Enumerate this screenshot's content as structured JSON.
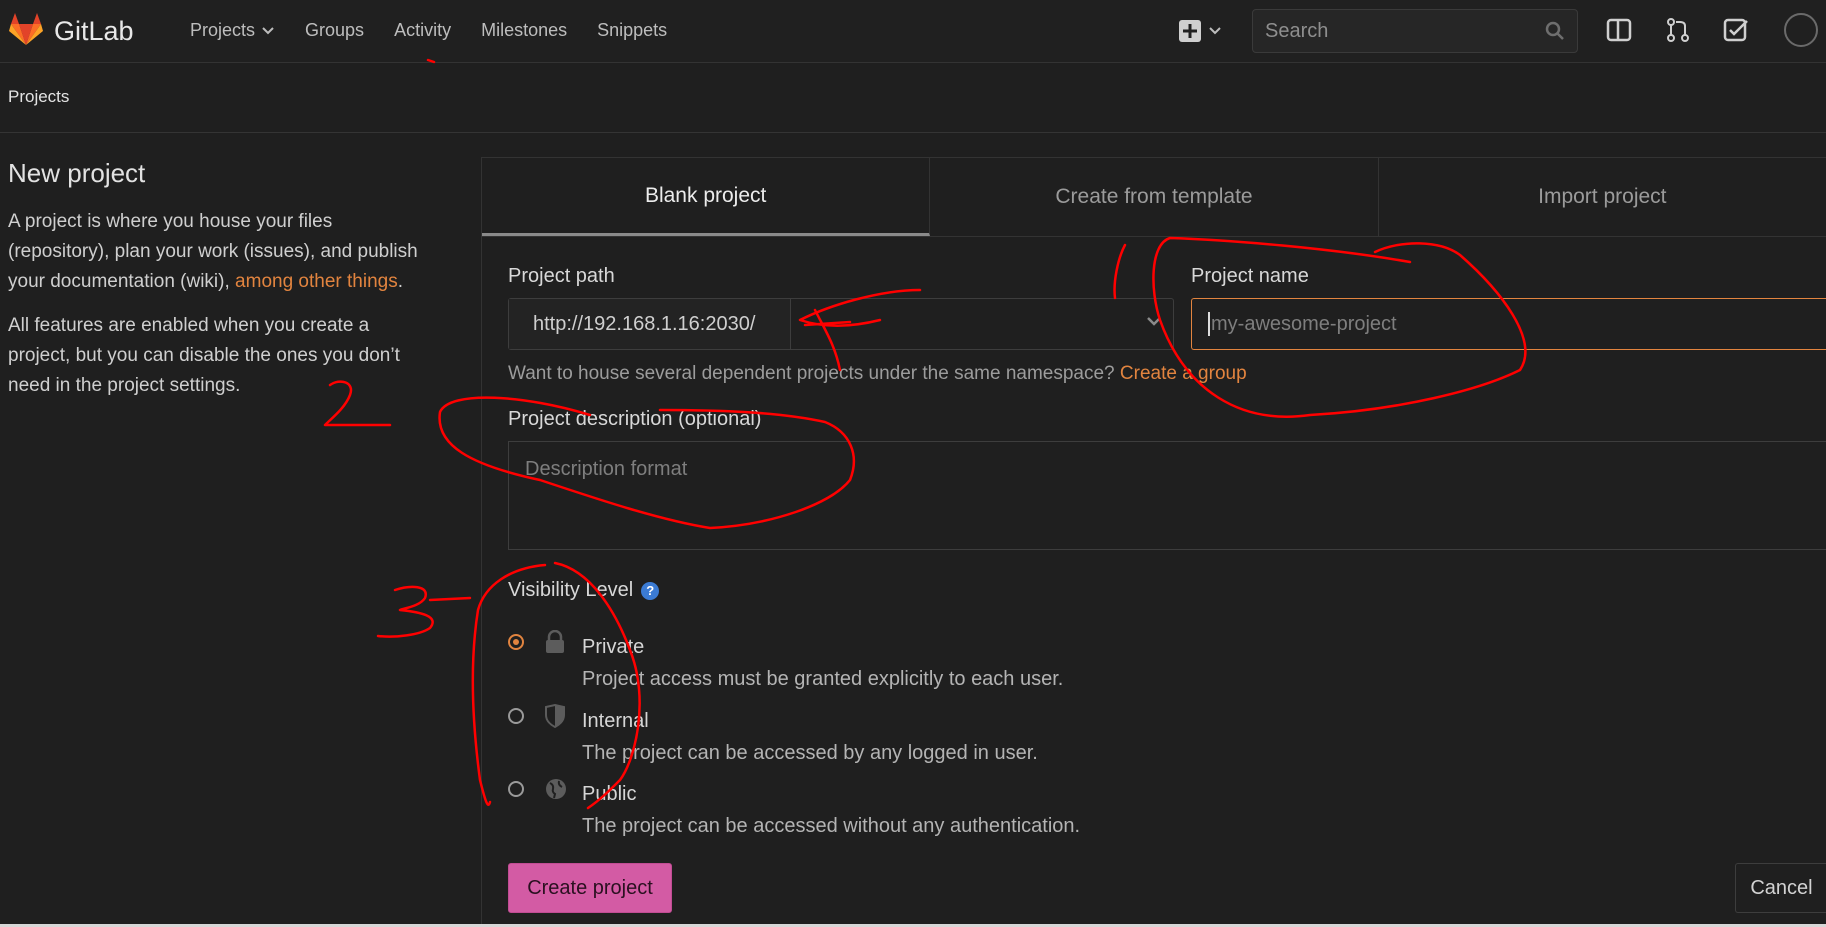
{
  "app": {
    "name": "GitLab"
  },
  "nav": {
    "projects": "Projects",
    "groups": "Groups",
    "activity": "Activity",
    "milestones": "Milestones",
    "snippets": "Snippets"
  },
  "search": {
    "placeholder": "Search"
  },
  "breadcrumb": {
    "current": "Projects"
  },
  "intro": {
    "title": "New project",
    "para1_text": "A project is where you house your files (repository), plan your work (issues), and publish your documentation (wiki), ",
    "para1_link": "among other things",
    "para1_end": ".",
    "para2": "All features are enabled when you create a project, but you can disable the ones you don’t need in the project settings."
  },
  "tabs": {
    "blank": "Blank project",
    "template": "Create from template",
    "import": "Import project"
  },
  "form": {
    "path_label": "Project path",
    "path_prefix": "http://192.168.1.16:2030/",
    "name_label": "Project name",
    "name_placeholder": "my-awesome-project",
    "help_text": "Want to house several dependent projects under the same namespace? ",
    "help_link": "Create a group",
    "desc_label": "Project description (optional)",
    "desc_placeholder": "Description format",
    "visibility_label": "Visibility Level",
    "visibility_help": "?"
  },
  "visibility": [
    {
      "title": "Private",
      "desc": "Project access must be granted explicitly to each user.",
      "icon": "lock-icon",
      "selected": true
    },
    {
      "title": "Internal",
      "desc": "The project can be accessed by any logged in user.",
      "icon": "shield-icon",
      "selected": false
    },
    {
      "title": "Public",
      "desc": "The project can be accessed without any authentication.",
      "icon": "globe-icon",
      "selected": false
    }
  ],
  "buttons": {
    "create": "Create project",
    "cancel": "Cancel"
  },
  "colors": {
    "accent": "#e2843f",
    "primary_button": "#d35ba4",
    "annotation": "#ff0000"
  }
}
